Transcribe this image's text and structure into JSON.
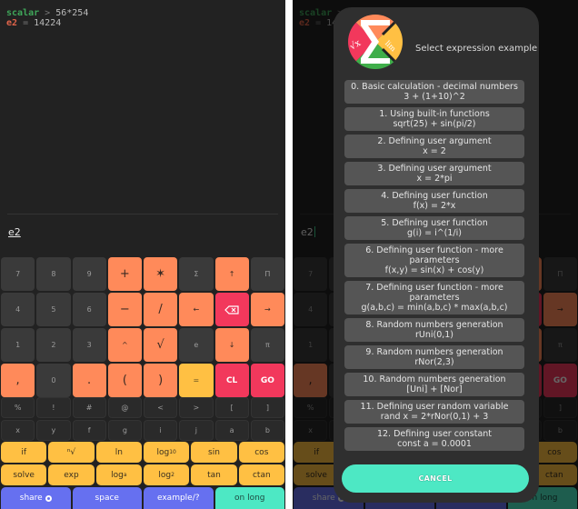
{
  "console": {
    "prompt_label": "scalar",
    "prompt_sep": ">",
    "expression": "56*254",
    "result_var": "e2",
    "result_eq": "=",
    "result_value": "14224"
  },
  "input": {
    "value": "e2"
  },
  "keypad": {
    "main": [
      {
        "label": "7",
        "style": "num"
      },
      {
        "label": "8",
        "style": "num"
      },
      {
        "label": "9",
        "style": "num"
      },
      {
        "label": "+",
        "style": "op"
      },
      {
        "label": "✶",
        "style": "op"
      },
      {
        "label": "Σ",
        "style": "num"
      },
      {
        "label": "↑",
        "style": "op-small"
      },
      {
        "label": "Π",
        "style": "num"
      },
      {
        "label": "4",
        "style": "num"
      },
      {
        "label": "5",
        "style": "num"
      },
      {
        "label": "6",
        "style": "num"
      },
      {
        "label": "−",
        "style": "op"
      },
      {
        "label": "/",
        "style": "op"
      },
      {
        "label": "←",
        "style": "op-small"
      },
      {
        "label": "backspace",
        "style": "red-icon"
      },
      {
        "label": "→",
        "style": "op-small"
      },
      {
        "label": "1",
        "style": "num"
      },
      {
        "label": "2",
        "style": "num"
      },
      {
        "label": "3",
        "style": "num"
      },
      {
        "label": "^",
        "style": "op-small"
      },
      {
        "label": "√",
        "style": "op"
      },
      {
        "label": "e",
        "style": "num"
      },
      {
        "label": "↓",
        "style": "op-small"
      },
      {
        "label": "π",
        "style": "num"
      },
      {
        "label": ",",
        "style": "op"
      },
      {
        "label": "0",
        "style": "num"
      },
      {
        "label": ".",
        "style": "op"
      },
      {
        "label": "(",
        "style": "op"
      },
      {
        "label": ")",
        "style": "op"
      },
      {
        "label": "=",
        "style": "yellow"
      },
      {
        "label": "CL",
        "style": "red"
      },
      {
        "label": "GO",
        "style": "red"
      }
    ],
    "symbols": [
      "%",
      "!",
      "#",
      "@",
      "<",
      ">",
      "[",
      "]",
      "x",
      "y",
      "f",
      "g",
      "i",
      "j",
      "a",
      "b"
    ],
    "functions": [
      {
        "label": "if"
      },
      {
        "label": "ⁿ√"
      },
      {
        "label": "ln"
      },
      {
        "label": "log",
        "sub": "10"
      },
      {
        "label": "sin"
      },
      {
        "label": "cos"
      },
      {
        "label": "solve"
      },
      {
        "label": "exp"
      },
      {
        "label": "log",
        "sub": "a"
      },
      {
        "label": "log",
        "sub": "2"
      },
      {
        "label": "tan"
      },
      {
        "label": "ctan"
      }
    ],
    "bottom": {
      "share": "share",
      "space": "space",
      "example": "example/?",
      "on_long": "on long"
    }
  },
  "dialog": {
    "title": "Select expression example",
    "examples": [
      {
        "title": "0. Basic calculation - decimal numbers",
        "expr": "3 + (1+10)^2"
      },
      {
        "title": "1. Using built-in functions",
        "expr": "sqrt(25) + sin(pi/2)"
      },
      {
        "title": "2. Defining user argument",
        "expr": "x = 2"
      },
      {
        "title": "3. Defining user argument",
        "expr": "x = 2*pi"
      },
      {
        "title": "4. Defining user function",
        "expr": "f(x) = 2*x"
      },
      {
        "title": "5. Defining user function",
        "expr": "g(i) = i^(1/i)"
      },
      {
        "title": "6. Defining user function - more parameters",
        "expr": "f(x,y) = sin(x) + cos(y)"
      },
      {
        "title": "7. Defining user function - more parameters",
        "expr": "g(a,b,c) = min(a,b,c) * max(a,b,c)"
      },
      {
        "title": "8. Random numbers generation",
        "expr": "rUni(0,1)"
      },
      {
        "title": "9. Random numbers generation",
        "expr": "rNor(2,3)"
      },
      {
        "title": "10. Random numbers generation",
        "expr": "[Uni] + [Nor]"
      },
      {
        "title": "11. Defining user random variable",
        "expr": "rand x = 2*rNor(0,1) + 3"
      },
      {
        "title": "12. Defining user constant",
        "expr": "const a = 0.0001"
      }
    ],
    "cancel_label": "CANCEL"
  },
  "colors": {
    "background": "#222222",
    "operator": "#ff8a5a",
    "danger": "#f2385c",
    "function": "#ffc043",
    "action_blue": "#6670f0",
    "accent_teal": "#4de8c4",
    "prompt_green": "#3fa65a",
    "result_red": "#e0644a"
  }
}
